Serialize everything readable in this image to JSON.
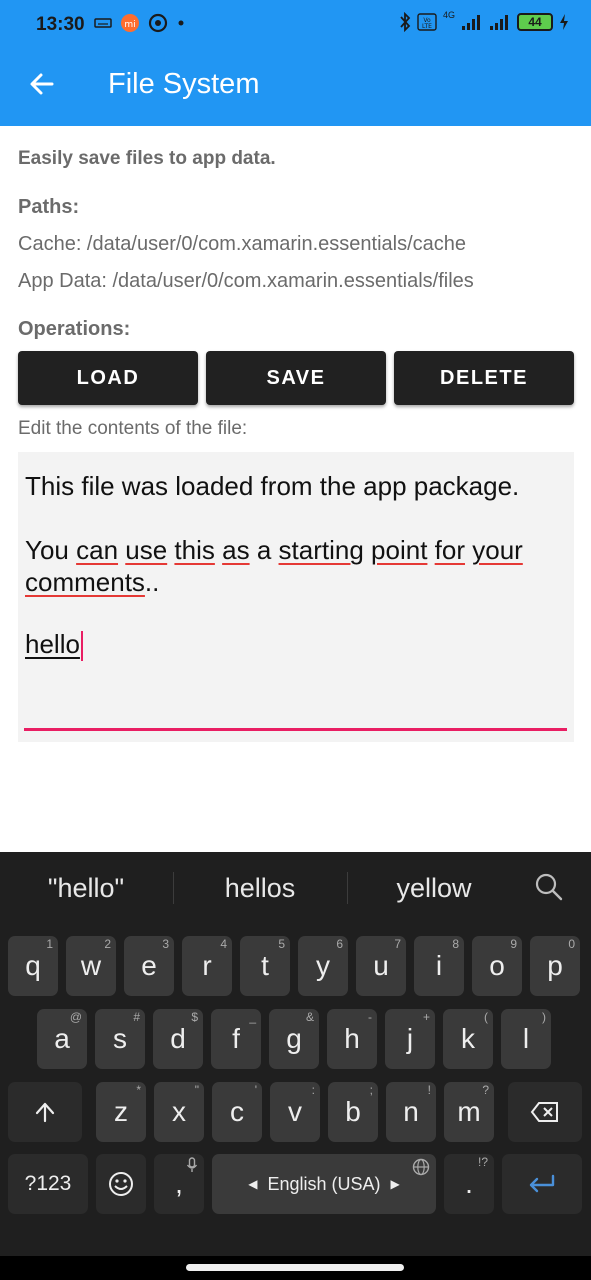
{
  "status_bar": {
    "time": "13:30",
    "battery": "44",
    "signal": "4G"
  },
  "app_bar": {
    "title": "File System"
  },
  "content": {
    "subtitle": "Easily save files to app data.",
    "paths_label": "Paths:",
    "cache_path": "Cache: /data/user/0/com.xamarin.essentials/cache",
    "app_data_path": "App Data: /data/user/0/com.xamarin.essentials/files",
    "operations_label": "Operations:",
    "buttons": {
      "load": "LOAD",
      "save": "SAVE",
      "delete": "DELETE"
    },
    "edit_label": "Edit the contents of the file:",
    "editor": {
      "line1": "This file was loaded from the app package.",
      "line2_words": [
        "You",
        "can",
        "use",
        "this",
        "as",
        "a",
        "starting",
        "point",
        "for",
        "your",
        "comments",
        ".."
      ],
      "line3": "hello"
    }
  },
  "keyboard": {
    "suggestions": [
      "\"hello\"",
      "hellos",
      "yellow"
    ],
    "row1": [
      {
        "k": "q",
        "h": "1"
      },
      {
        "k": "w",
        "h": "2"
      },
      {
        "k": "e",
        "h": "3"
      },
      {
        "k": "r",
        "h": "4"
      },
      {
        "k": "t",
        "h": "5"
      },
      {
        "k": "y",
        "h": "6"
      },
      {
        "k": "u",
        "h": "7"
      },
      {
        "k": "i",
        "h": "8"
      },
      {
        "k": "o",
        "h": "9"
      },
      {
        "k": "p",
        "h": "0"
      }
    ],
    "row2": [
      {
        "k": "a",
        "h": "@"
      },
      {
        "k": "s",
        "h": "#"
      },
      {
        "k": "d",
        "h": "$"
      },
      {
        "k": "f",
        "h": "_"
      },
      {
        "k": "g",
        "h": "&"
      },
      {
        "k": "h",
        "h": "-"
      },
      {
        "k": "j",
        "h": "+"
      },
      {
        "k": "k",
        "h": "("
      },
      {
        "k": "l",
        "h": ")"
      }
    ],
    "row3": [
      {
        "k": "z",
        "h": "*"
      },
      {
        "k": "x",
        "h": "\""
      },
      {
        "k": "c",
        "h": "'"
      },
      {
        "k": "v",
        "h": ":"
      },
      {
        "k": "b",
        "h": ";"
      },
      {
        "k": "n",
        "h": "!"
      },
      {
        "k": "m",
        "h": "?"
      }
    ],
    "symbols_key": "?123",
    "comma_key": ",",
    "space_label": "English (USA)",
    "period_key": ".",
    "period_hint": "!?"
  }
}
